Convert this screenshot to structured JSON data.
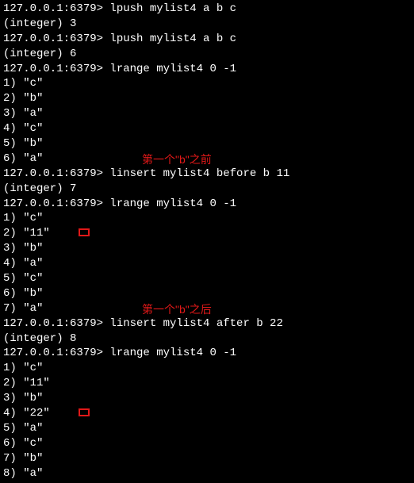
{
  "prompt": "127.0.0.1:6379> ",
  "blocks": [
    {
      "type": "cmd",
      "cmd": "lpush mylist4 a b c",
      "response": "(integer) 3"
    },
    {
      "type": "cmd",
      "cmd": "lpush mylist4 a b c",
      "response": "(integer) 6"
    },
    {
      "type": "cmd",
      "cmd": "lrange mylist4 0 -1",
      "list": [
        "\"c\"",
        "\"b\"",
        "\"a\"",
        "\"c\"",
        "\"b\"",
        "\"a\""
      ]
    },
    {
      "type": "cmd",
      "cmd": "linsert mylist4 before b 11",
      "response": "(integer) 7",
      "annotation_before": "第一个\"b\"之前"
    },
    {
      "type": "cmd",
      "cmd": "lrange mylist4 0 -1",
      "list": [
        "\"c\"",
        "\"11\"",
        "\"b\"",
        "\"a\"",
        "\"c\"",
        "\"b\"",
        "\"a\""
      ],
      "highlight_index": 2
    },
    {
      "type": "cmd",
      "cmd": "linsert mylist4 after b 22",
      "response": "(integer) 8",
      "annotation_before": "第一个\"b\"之后"
    },
    {
      "type": "cmd",
      "cmd": "lrange mylist4 0 -1",
      "list": [
        "\"c\"",
        "\"11\"",
        "\"b\"",
        "\"22\"",
        "\"a\"",
        "\"c\"",
        "\"b\"",
        "\"a\""
      ],
      "highlight_index": 4
    }
  ],
  "annotations": {
    "before_b": "第一个\"b\"之前",
    "after_b": "第一个\"b\"之后"
  }
}
